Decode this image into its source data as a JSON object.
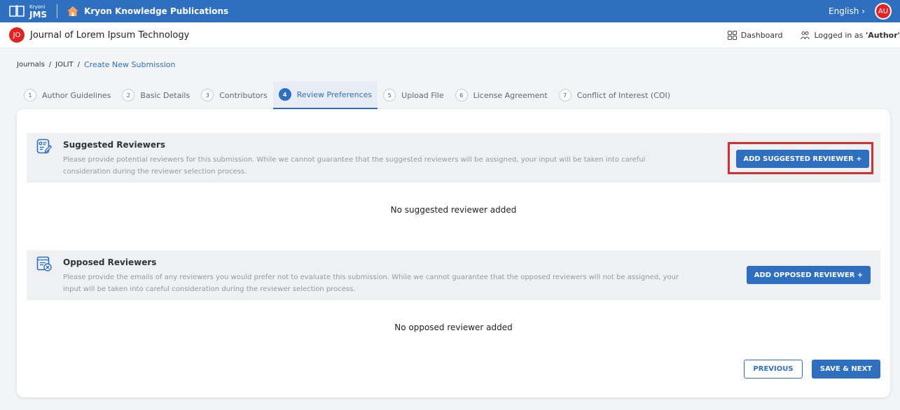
{
  "topbar": {
    "logo_small": "Kryoni",
    "logo_big": "JMS",
    "publisher": "Kryon Knowledge Publications",
    "language": "English ›",
    "user_initials": "AU"
  },
  "journal": {
    "initials": "JO",
    "title": "Journal of Lorem Ipsum Technology",
    "dashboard": "Dashboard",
    "logged_in_prefix": "Logged in as ",
    "logged_in_role": "'Author'"
  },
  "breadcrumb": {
    "items": [
      "Journals",
      "JOLIT",
      "Create New Submission"
    ],
    "separator": "/"
  },
  "steps": [
    {
      "num": "1",
      "label": "Author Guidelines"
    },
    {
      "num": "2",
      "label": "Basic Details"
    },
    {
      "num": "3",
      "label": "Contributors"
    },
    {
      "num": "4",
      "label": "Review Preferences"
    },
    {
      "num": "5",
      "label": "Upload File"
    },
    {
      "num": "6",
      "label": "License Agreement"
    },
    {
      "num": "7",
      "label": "Conflict of Interest (COI)"
    }
  ],
  "suggested": {
    "title": "Suggested Reviewers",
    "description": "Please provide potential reviewers for this submission. While we cannot guarantee that the suggested reviewers will be assigned, your input will be taken into careful consideration during the reviewer selection process.",
    "button": "ADD SUGGESTED REVIEWER +",
    "empty": "No suggested reviewer added"
  },
  "opposed": {
    "title": "Opposed Reviewers",
    "description": "Please provide the emails of any reviewers you would prefer not to evaluate this submission. While we cannot guarantee that the opposed reviewers will not be assigned, your input will be taken into careful consideration during the reviewer selection process.",
    "button": "ADD OPPOSED REVIEWER +",
    "empty": "No opposed reviewer added"
  },
  "footer": {
    "previous": "PREVIOUS",
    "save_next": "SAVE & NEXT"
  },
  "icons": {
    "logo": "book-icon",
    "home": "home-icon",
    "dashboard": "grid-icon",
    "user": "users-icon",
    "suggested": "reviewer-edit-icon",
    "opposed": "reviewer-remove-icon"
  },
  "colors": {
    "primary": "#2f6fbf",
    "avatar": "#e02424",
    "highlight": "#d32f2f"
  }
}
